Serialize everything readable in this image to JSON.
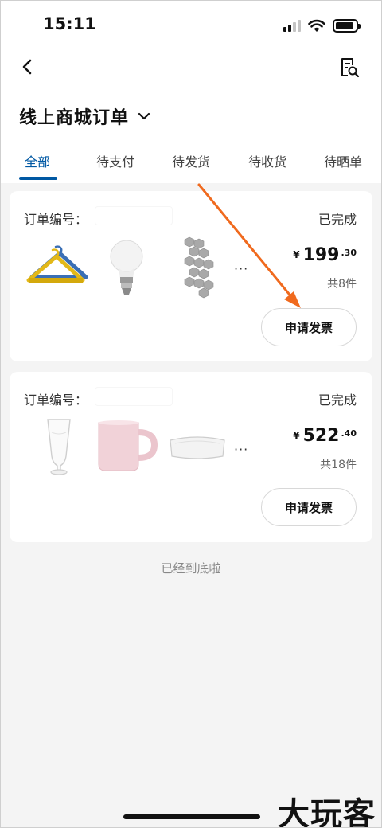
{
  "status_bar": {
    "time": "15:11"
  },
  "header": {
    "title": "线上商城订单",
    "tabs": [
      {
        "label": "全部",
        "active": true
      },
      {
        "label": "待支付",
        "active": false
      },
      {
        "label": "待发货",
        "active": false
      },
      {
        "label": "待收货",
        "active": false
      },
      {
        "label": "待晒单",
        "active": false
      }
    ]
  },
  "orders": [
    {
      "order_label": "订单编号：",
      "status": "已完成",
      "currency": "¥",
      "price_int": "199",
      "price_dec": ".30",
      "count": "共8件",
      "more": "···",
      "action_label": "申请发票",
      "items": [
        "hanger-icon",
        "lightbulb-icon",
        "hex-panel-icon"
      ]
    },
    {
      "order_label": "订单编号：",
      "status": "已完成",
      "currency": "¥",
      "price_int": "522",
      "price_dec": ".40",
      "count": "共18件",
      "more": "···",
      "action_label": "申请发票",
      "items": [
        "glass-icon",
        "mug-icon",
        "pillow-icon"
      ]
    }
  ],
  "footer": {
    "end_text": "已经到底啦"
  },
  "watermark": "大玩客",
  "colors": {
    "accent": "#0058a3",
    "arrow": "#f06a1e",
    "background": "#f4f4f4"
  }
}
